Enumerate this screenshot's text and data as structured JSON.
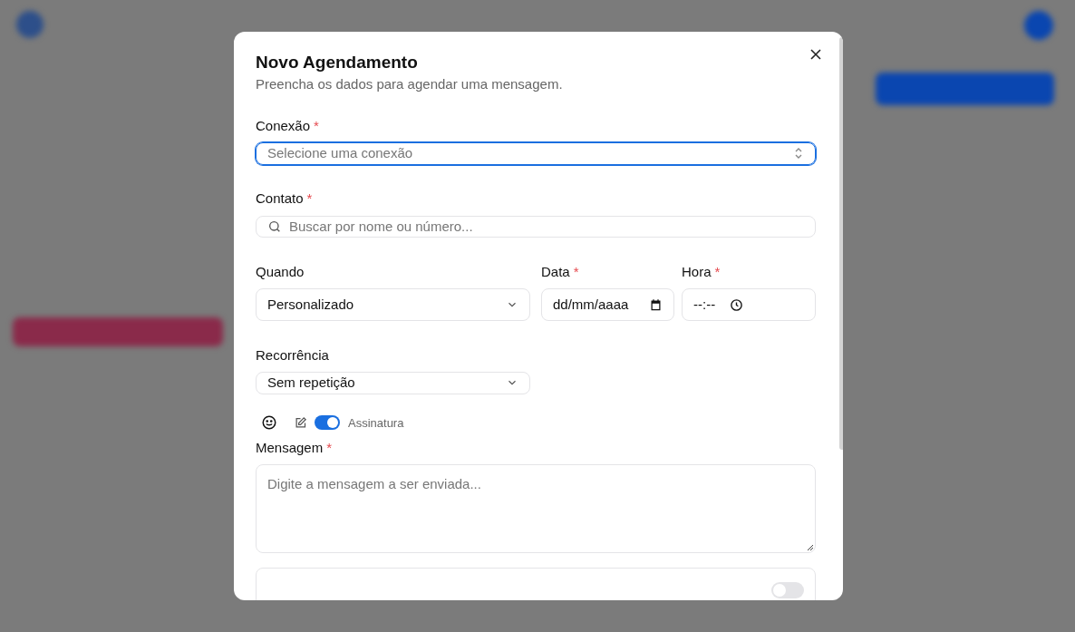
{
  "dialog": {
    "title": "Novo Agendamento",
    "subtitle": "Preencha os dados para agendar uma mensagem.",
    "connection": {
      "label": "Conexão",
      "required_mark": "*",
      "placeholder": "Selecione uma conexão",
      "focused": true
    },
    "contact": {
      "label": "Contato",
      "required_mark": "*",
      "placeholder": "Buscar por nome ou número..."
    },
    "when": {
      "label": "Quando",
      "value": "Personalizado"
    },
    "date": {
      "label": "Data",
      "required_mark": "*",
      "value": "dd/mm/aaaa"
    },
    "time": {
      "label": "Hora",
      "required_mark": "*",
      "value": "--:--"
    },
    "recurrence": {
      "label": "Recorrência",
      "value": "Sem repetição"
    },
    "signature": {
      "label": "Assinatura",
      "on": true
    },
    "message": {
      "label": "Mensagem",
      "required_mark": "*",
      "placeholder": "Digite a mensagem a ser enviada..."
    },
    "extra_option": {
      "on": false
    }
  }
}
